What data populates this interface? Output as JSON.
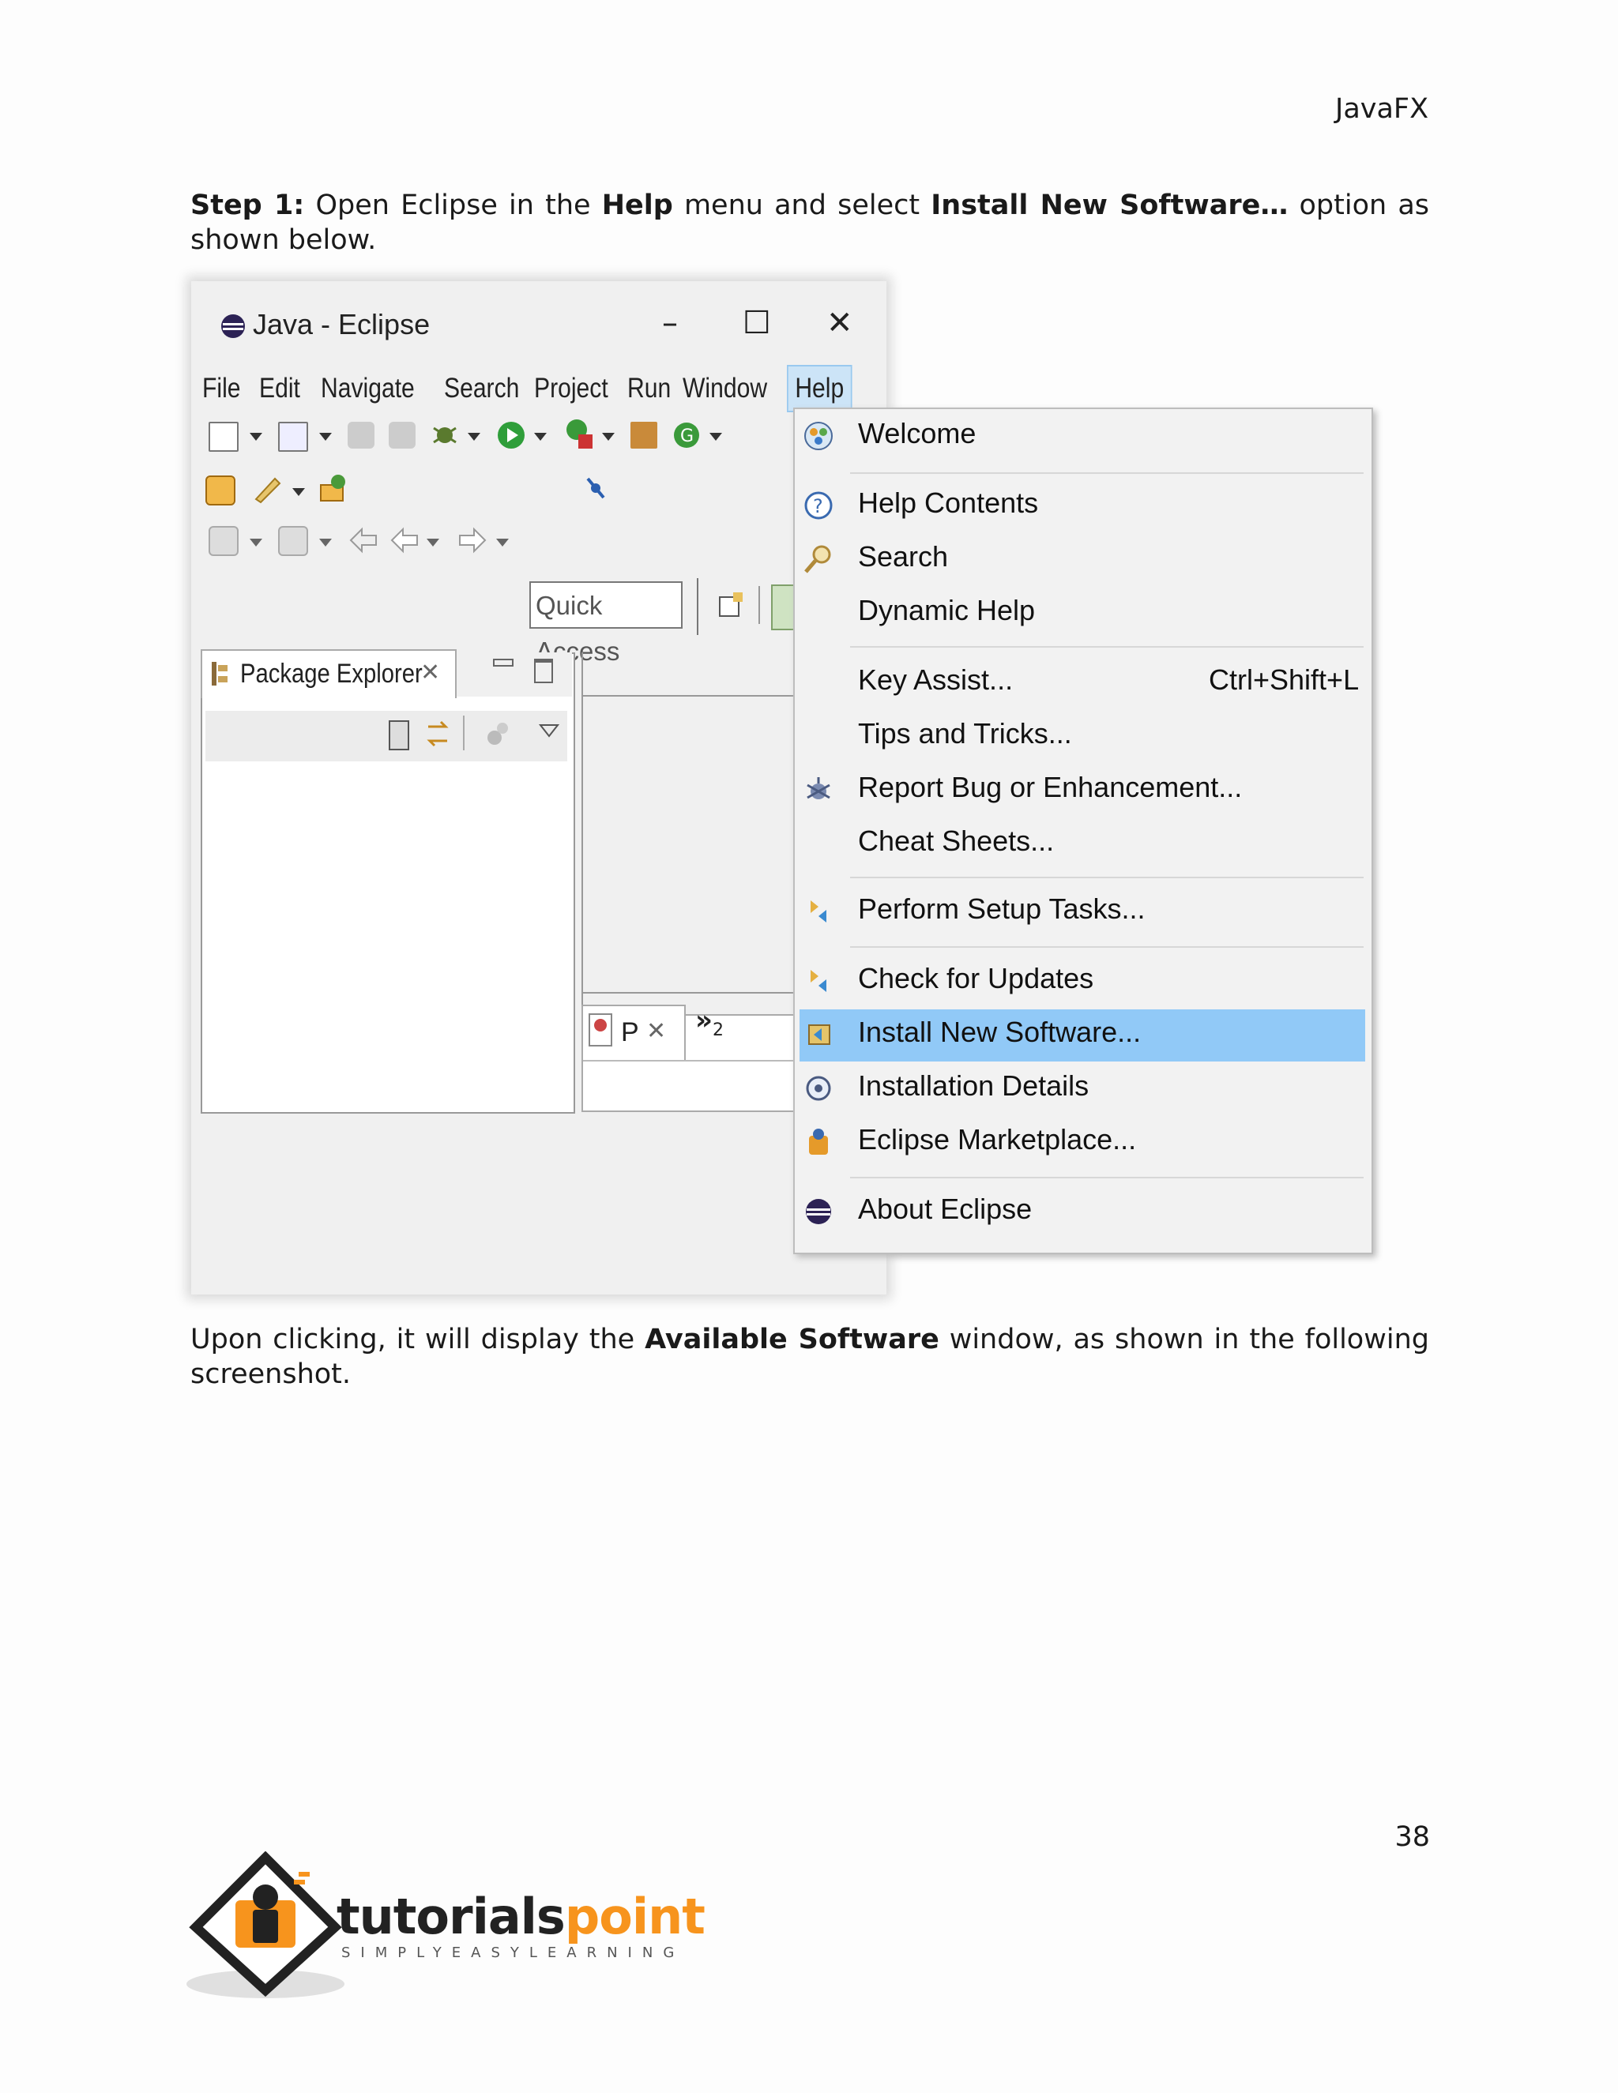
{
  "header": {
    "title": "JavaFX"
  },
  "step1": {
    "prefix": "Step 1:",
    "t1": " Open Eclipse in the ",
    "help": "Help",
    "t2": " menu and select ",
    "install": "Install New Software…",
    "t3": " option as shown below."
  },
  "after": {
    "t1": "Upon clicking, it will display the ",
    "bold": "Available Software",
    "t2": " window, as shown in the following screenshot."
  },
  "page_number": "38",
  "screenshot": {
    "window_title": "Java - Eclipse",
    "controls": {
      "minimize": "–",
      "maximize": "☐",
      "close": "✕"
    },
    "menubar": [
      "File",
      "Edit",
      "Navigate",
      "Search",
      "Project",
      "Run",
      "Window",
      "Help"
    ],
    "quick_access": "Quick Access",
    "package_explorer_tab": "Package Explorer",
    "tab_close": "✕",
    "small_tab": "P",
    "overflow": "»",
    "overflow_count": "2",
    "help_menu": {
      "welcome": "Welcome",
      "help_contents": "Help Contents",
      "search": "Search",
      "dynamic_help": "Dynamic Help",
      "key_assist": "Key Assist...",
      "key_assist_shortcut": "Ctrl+Shift+L",
      "tips": "Tips and Tricks...",
      "report_bug": "Report Bug or Enhancement...",
      "cheat_sheets": "Cheat Sheets...",
      "perform_setup": "Perform Setup Tasks...",
      "check_updates": "Check for Updates",
      "install_new": "Install New Software...",
      "installation_details": "Installation Details",
      "marketplace": "Eclipse Marketplace...",
      "about": "About Eclipse"
    },
    "highlight_color": "#91c9f7"
  },
  "logo": {
    "brand_dark": "tutorials",
    "brand_orange": "point",
    "tagline": "SIMPLYEASYLEARNING",
    "colors": {
      "dark": "#222222",
      "orange": "#f7941d"
    }
  }
}
